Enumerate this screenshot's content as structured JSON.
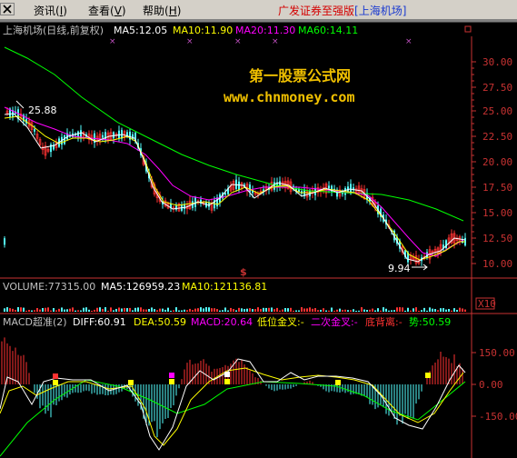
{
  "menu": [
    {
      "label": "资讯",
      "key": "I"
    },
    {
      "label": "查看",
      "key": "V"
    },
    {
      "label": "帮助",
      "key": "H"
    }
  ],
  "app_title": {
    "prefix": "广发证券至强版",
    "stock": "[上海机场]"
  },
  "price_panel": {
    "stock": "上海机场(日线,前复权)",
    "ma5": "MA5:12.05",
    "ma10": "MA10:11.90",
    "ma20": "MA20:11.30",
    "ma60": "MA60:14.11",
    "ticks": [
      "30.00",
      "27.50",
      "25.00",
      "22.50",
      "20.00",
      "17.50",
      "15.00",
      "12.50",
      "10.00"
    ],
    "high_marker": "25.88",
    "low_marker": "9.94"
  },
  "watermark": {
    "line1": "第一股票公式网",
    "line2": "www.chnmoney.com"
  },
  "volume_panel": {
    "volume": "VOLUME:77315.00",
    "ma5": "MA5:126959.23",
    "ma10": "MA10:121136.81",
    "scale": "X10",
    "marker": "$"
  },
  "macd_panel": {
    "name": "MACD超准(2)",
    "diff": "DIFF:60.91",
    "dea": "DEA:50.59",
    "macd": "MACD:20.64",
    "cross1": "低位金叉:-",
    "cross2": "二次金叉:-",
    "bottom": "底背离:-",
    "trend": "势:50.59",
    "ticks": [
      "150.00",
      "0.00",
      "-150.00"
    ]
  },
  "colors": {
    "axis": "#c83232",
    "ma5": "#ffffff",
    "ma10": "#ffff00",
    "ma20": "#ff00ff",
    "ma60": "#00ff00",
    "up": "#ff3232",
    "down": "#54ffff"
  },
  "icons": [
    "app-icon",
    "close-icon"
  ]
}
